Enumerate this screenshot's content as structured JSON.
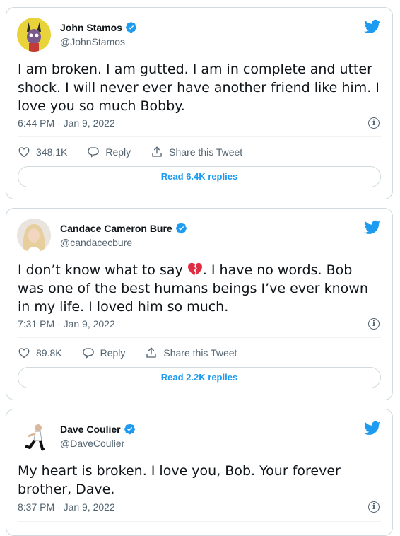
{
  "tweets": [
    {
      "name": "John Stamos",
      "handle": "@JohnStamos",
      "text": "I am broken. I am gutted.  I am in complete and utter shock.  I will never ever have another friend like him.  I love you so much Bobby.",
      "time": "6:44 PM · Jan 9, 2022",
      "likes": "348.1K",
      "reply_label": "Reply",
      "share_label": "Share this Tweet",
      "replies_button": "Read 6.4K replies"
    },
    {
      "name": "Candace Cameron Bure",
      "handle": "@candacecbure",
      "text_before_emoji": "I don’t know what to say ",
      "text_after_emoji": ". I have no words. Bob was one of the best humans beings I’ve ever known in my life. I loved him so much.",
      "time": "7:31 PM · Jan 9, 2022",
      "likes": "89.8K",
      "reply_label": "Reply",
      "share_label": "Share this Tweet",
      "replies_button": "Read 2.2K replies"
    },
    {
      "name": "Dave Coulier",
      "handle": "@DaveCoulier",
      "text": "My heart is broken. I love you, Bob. Your forever brother, Dave.",
      "time": "8:37 PM · Jan 9, 2022"
    }
  ],
  "icons": {
    "twitter": "twitter-bird-icon",
    "verified": "verified-badge-icon",
    "like": "heart-icon",
    "reply": "reply-bubble-icon",
    "share": "share-upload-icon",
    "info": "info-icon",
    "emoji": "broken-heart-emoji"
  },
  "colors": {
    "accent": "#1d9bf0",
    "text": "#0f1419",
    "secondary": "#536471",
    "border": "#cfd9de"
  }
}
